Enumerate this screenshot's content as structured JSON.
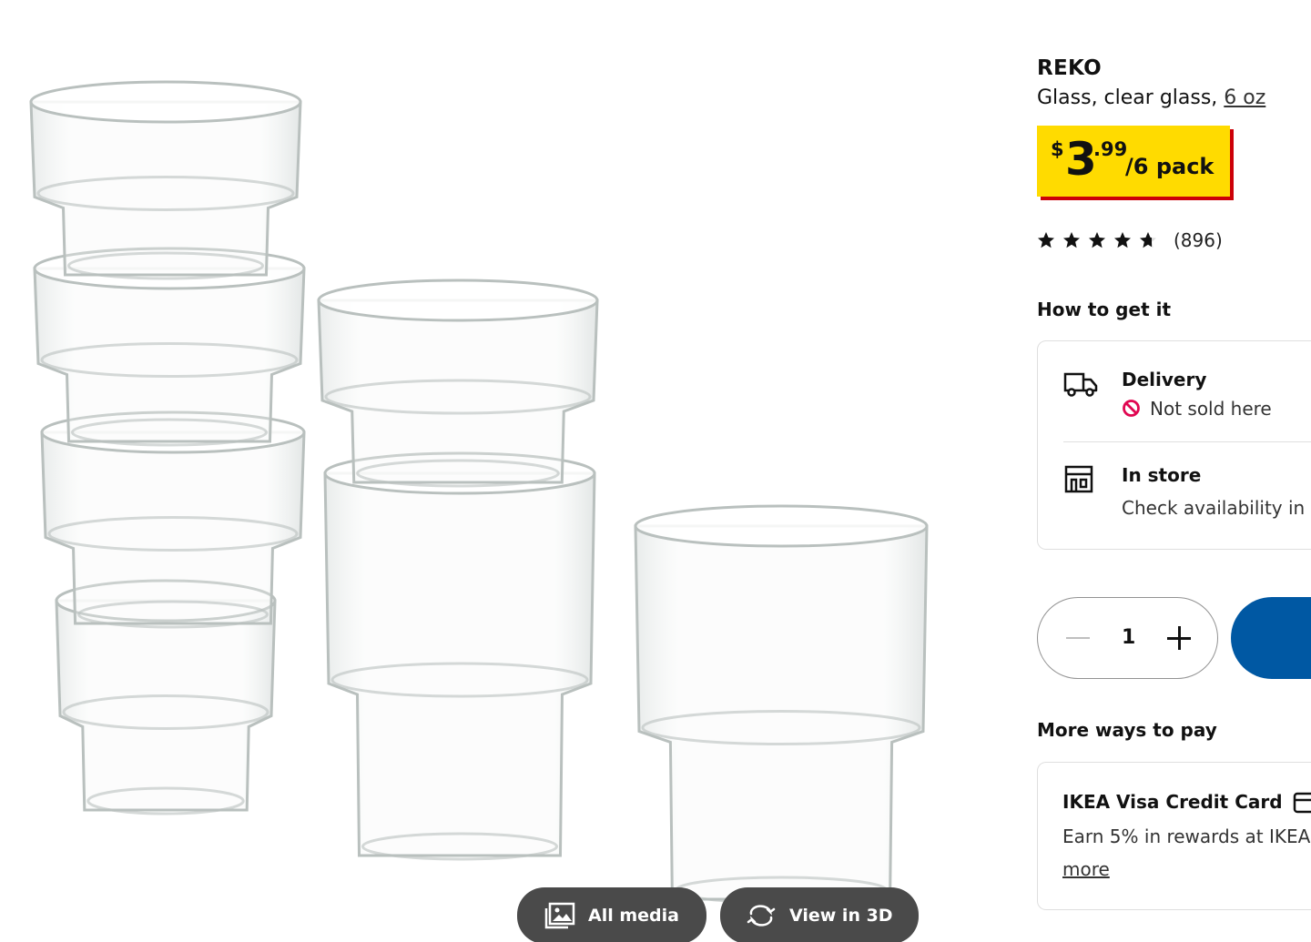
{
  "product": {
    "name": "REKO",
    "description": "Glass, clear glass, ",
    "size_link": "6 oz"
  },
  "price": {
    "currency": "$",
    "integer": "3",
    "decimal": ".99",
    "unit": "/6 pack",
    "box_color": "#ffdb00",
    "shadow_color": "#cc0008"
  },
  "rating": {
    "stars": 4.7,
    "count": "(896)"
  },
  "how_to_get": {
    "title": "How to get it",
    "delivery": {
      "title": "Delivery",
      "status": "Not sold here",
      "icon": "truck-icon"
    },
    "in_store": {
      "title": "In store",
      "status": "Check availability in",
      "icon": "store-icon"
    }
  },
  "quantity": {
    "value": "1"
  },
  "accent_color": "#0058a3",
  "more_ways_to_pay": {
    "title": "More ways to pay",
    "card_title": "IKEA Visa Credit Card",
    "card_text": "Earn 5% in rewards at IKEA",
    "link": "more"
  },
  "media": {
    "all_media": "All media",
    "view_3d": "View in 3D"
  }
}
